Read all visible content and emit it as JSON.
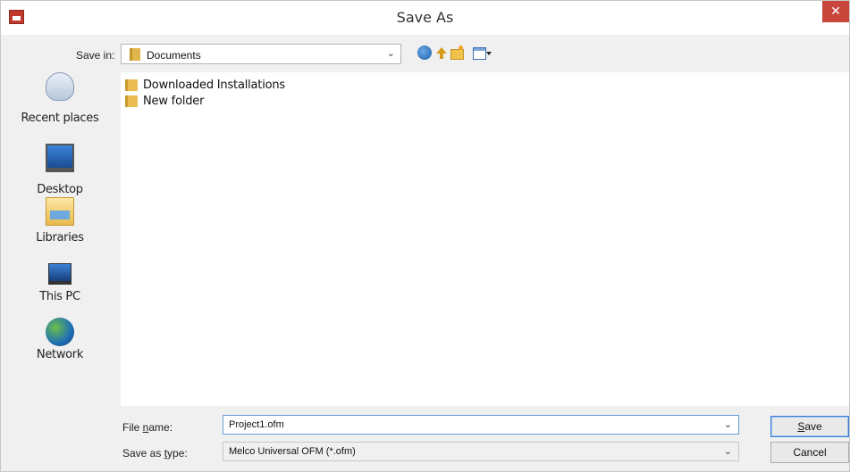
{
  "window": {
    "title": "Save As",
    "close_glyph": "✕",
    "app_icon": "app-icon"
  },
  "toolbar": {
    "save_in_label": "Save in:",
    "save_in_value": "Documents",
    "dropdown_glyph": "⌄",
    "icons": [
      "back-icon",
      "up-folder-icon",
      "new-folder-icon",
      "views-menu-icon"
    ]
  },
  "places": [
    {
      "label": "Recent places",
      "icon": "recent-places-icon"
    },
    {
      "label": "Desktop",
      "icon": "desktop-icon"
    },
    {
      "label": "Libraries",
      "icon": "libraries-icon"
    },
    {
      "label": "This PC",
      "icon": "this-pc-icon"
    },
    {
      "label": "Network",
      "icon": "network-icon"
    }
  ],
  "files": [
    {
      "name": "Downloaded Installations",
      "icon": "folder-icon"
    },
    {
      "name": "New folder",
      "icon": "folder-icon"
    }
  ],
  "form": {
    "file_name_label_pre": "File ",
    "file_name_label_u": "n",
    "file_name_label_post": "ame:",
    "file_name_value": "Project1.ofm",
    "save_type_label_pre": "Save as ",
    "save_type_label_u": "t",
    "save_type_label_post": "ype:",
    "save_type_value": "Melco Universal OFM (*.ofm)"
  },
  "buttons": {
    "save_u": "S",
    "save_rest": "ave",
    "cancel": "Cancel"
  }
}
